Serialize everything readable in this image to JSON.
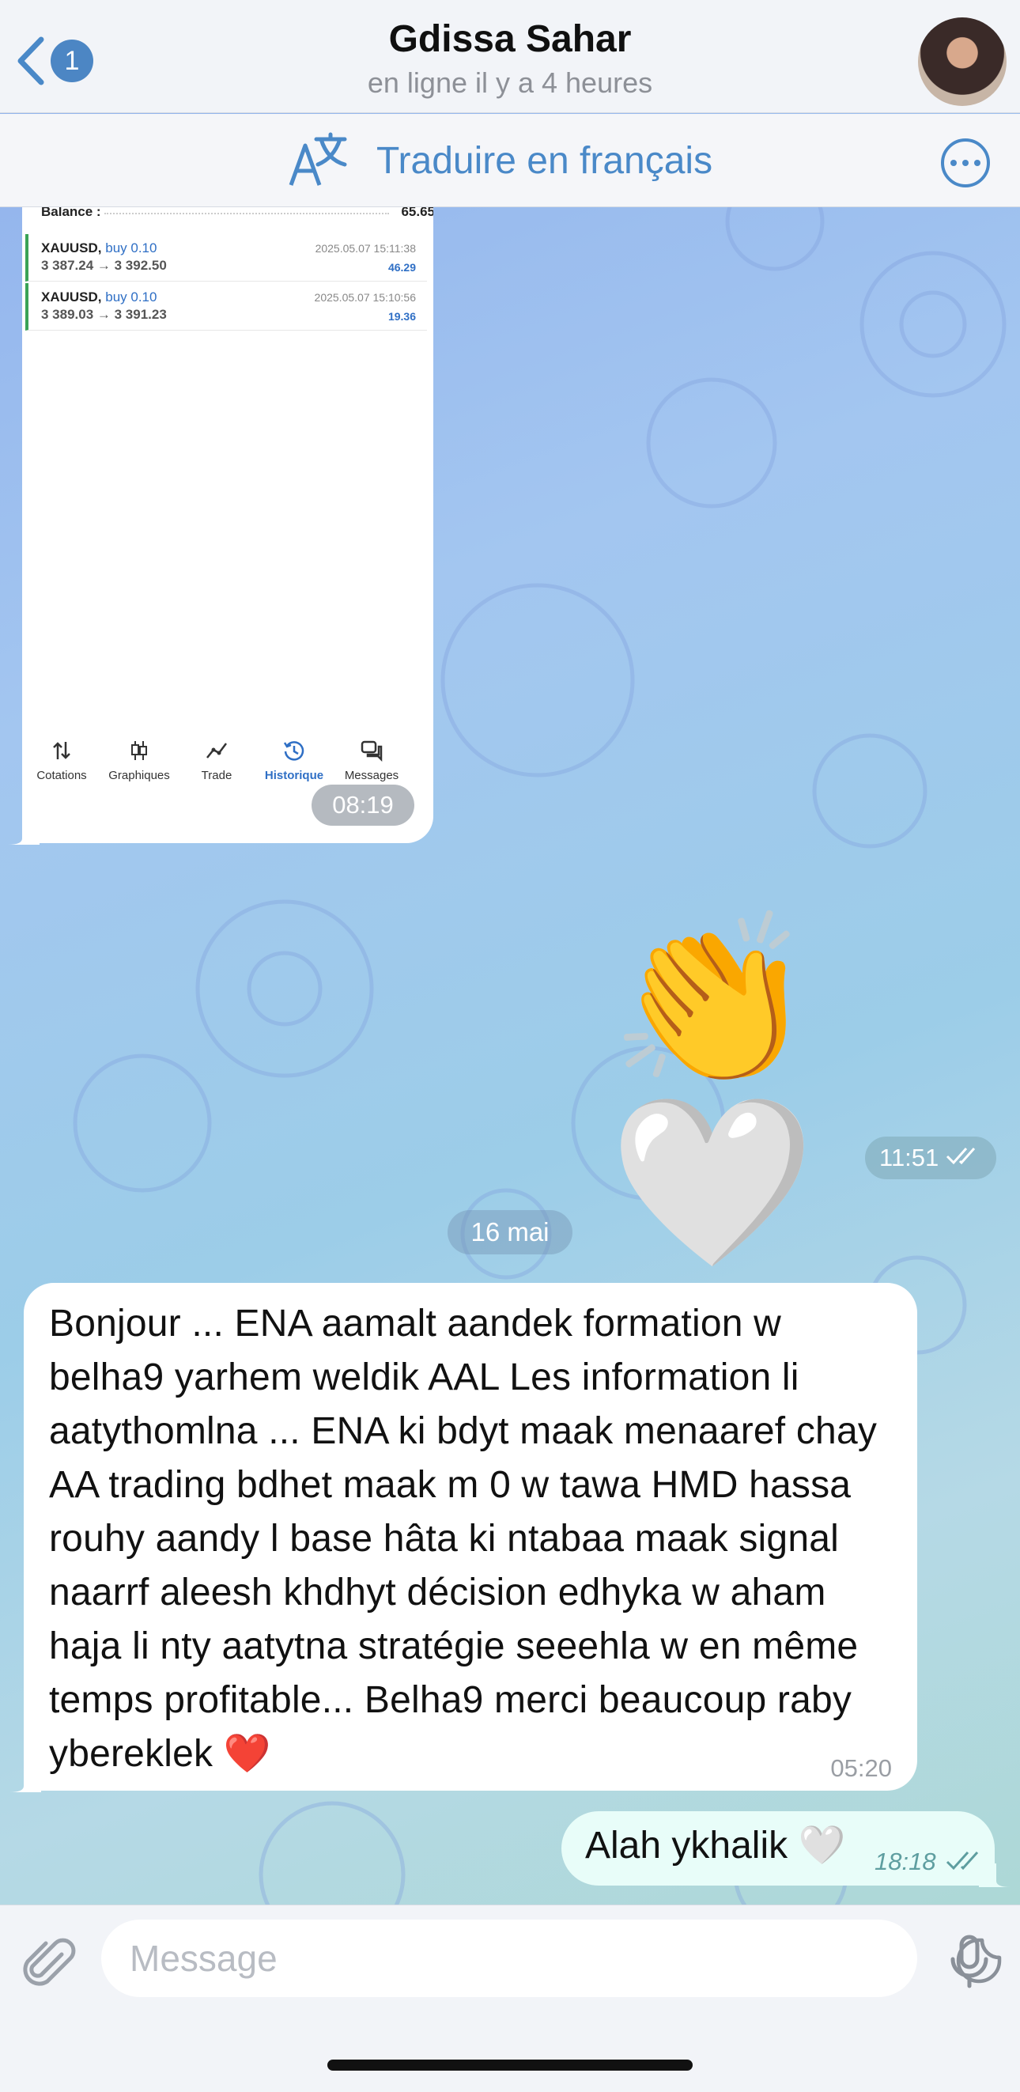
{
  "header": {
    "back_badge": "1",
    "contact_name": "Gdissa Sahar",
    "status": "en ligne il y a 4 heures"
  },
  "translate_bar": {
    "label": "Traduire en français"
  },
  "screenshot_message": {
    "balance_label": "Balance :",
    "balance_value": "65.65",
    "trades": [
      {
        "symbol": "XAUUSD,",
        "direction": "buy 0.10",
        "prices": "3 387.24 → 3 392.50",
        "datetime": "2025.05.07 15:11:38",
        "profit": "46.29"
      },
      {
        "symbol": "XAUUSD,",
        "direction": "buy 0.10",
        "prices": "3 389.03 → 3 391.23",
        "datetime": "2025.05.07 15:10:56",
        "profit": "19.36"
      }
    ],
    "tabs": [
      "Cotations",
      "Graphiques",
      "Trade",
      "Historique",
      "Messages"
    ],
    "time": "08:19"
  },
  "emoji_message": {
    "text": "👏🤍",
    "time": "11:51"
  },
  "date_separator": "16 mai",
  "incoming_message": {
    "text": "Bonjour ... ENA aamalt aandek formation w belha9 yarhem weldik AAL Les information li aatythomlna ... ENA ki bdyt maak menaaref chay AA trading bdhet maak m 0 w tawa HMD hassa rouhy aandy l base hâta ki ntabaa maak signal naarrf aleesh khdhyt décision edhyka w aham haja li nty aatytna stratégie seeehla w en même temps profitable... Belha9 merci beaucoup raby ybereklek ❤️",
    "time": "05:20"
  },
  "outgoing_message": {
    "text": "Alah ykhalik 🤍",
    "time": "18:18"
  },
  "input": {
    "placeholder": "Message",
    "value": ""
  },
  "colors": {
    "accent": "#4a89c8",
    "outgoing_bubble": "#e8fdf9",
    "incoming_bubble": "#ffffff",
    "trade_blue": "#2f6fc5",
    "trade_green": "#3aa356"
  }
}
